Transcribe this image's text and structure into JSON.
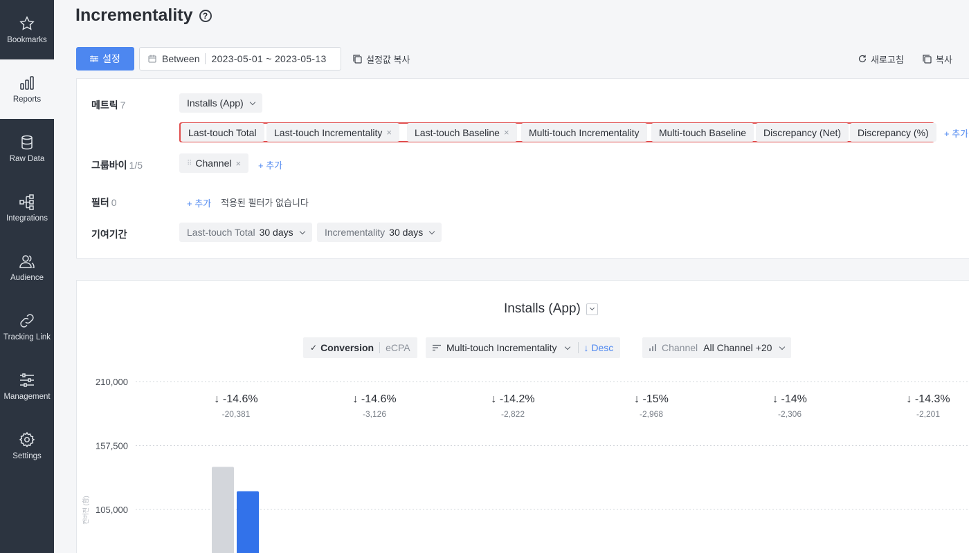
{
  "sidebar": {
    "items": [
      {
        "label": "Bookmarks",
        "icon": "star-icon"
      },
      {
        "label": "Reports",
        "icon": "bar-chart-icon"
      },
      {
        "label": "Raw Data",
        "icon": "database-icon"
      },
      {
        "label": "Integrations",
        "icon": "integrations-icon"
      },
      {
        "label": "Audience",
        "icon": "audience-icon"
      },
      {
        "label": "Tracking Link",
        "icon": "link-icon"
      },
      {
        "label": "Management",
        "icon": "sliders-icon"
      },
      {
        "label": "Settings",
        "icon": "gear-icon"
      }
    ]
  },
  "header": {
    "title": "Incrementality",
    "help": "?"
  },
  "toolbar": {
    "settings_label": "설정",
    "date_mode": "Between",
    "date_range": "2023-05-01 ~ 2023-05-13",
    "copy_settings_label": "설정값 복사",
    "refresh_label": "새로고침",
    "copy_label": "복사"
  },
  "settings": {
    "metric": {
      "label": "메트릭",
      "count": "7",
      "selected_event": "Installs (App)",
      "chips": [
        {
          "label": "Last-touch Total"
        },
        {
          "label": "Last-touch Incrementality",
          "x": "×"
        },
        {
          "label": "Last-touch Baseline",
          "x": "×"
        },
        {
          "label": "Multi-touch Incrementality"
        },
        {
          "label": "Multi-touch Baseline"
        },
        {
          "label": "Discrepancy (Net)"
        },
        {
          "label": "Discrepancy (%)"
        }
      ],
      "add_label": "+ 추가"
    },
    "groupby": {
      "label": "그룹바이",
      "count": "1/5",
      "chip": "Channel",
      "chip_x": "×",
      "drag": "⠿",
      "add_label": "+ 추가"
    },
    "filter": {
      "label": "필터",
      "count": "0",
      "add_label": "+ 추가",
      "empty_text": "적용된 필터가 없습니다"
    },
    "attribution": {
      "label": "기여기간",
      "windows": [
        {
          "name": "Last-touch Total",
          "value": "30 days"
        },
        {
          "name": "Incrementality",
          "value": "30 days"
        }
      ]
    }
  },
  "chart_card": {
    "title": "Installs (App)",
    "controls": {
      "conversion_label": "Conversion",
      "ecpa_label": "eCPA",
      "sort_metric": "Multi-touch Incrementality",
      "sort_dir": "Desc",
      "channel_label": "Channel",
      "channel_value": "All Channel +20"
    }
  },
  "chart_data": {
    "type": "bar",
    "ylabel": "컨버전 (합)",
    "y_ticks": [
      "210,000",
      "157,500",
      "105,000"
    ],
    "ylim": [
      0,
      210000
    ],
    "grid": true,
    "colors": {
      "series_a": "#d3d6db",
      "series_b": "#3272ea"
    },
    "series": [
      {
        "values": [
          140000
        ]
      },
      {
        "values": [
          120000
        ]
      }
    ],
    "annotations": [
      {
        "pct": "-14.6%",
        "diff": "-20,381"
      },
      {
        "pct": "-14.6%",
        "diff": "-3,126"
      },
      {
        "pct": "-14.2%",
        "diff": "-2,822"
      },
      {
        "pct": "-15%",
        "diff": "-2,968"
      },
      {
        "pct": "-14%",
        "diff": "-2,306"
      },
      {
        "pct": "-14.3%",
        "diff": "-2,201"
      }
    ],
    "arrow": "↓"
  }
}
